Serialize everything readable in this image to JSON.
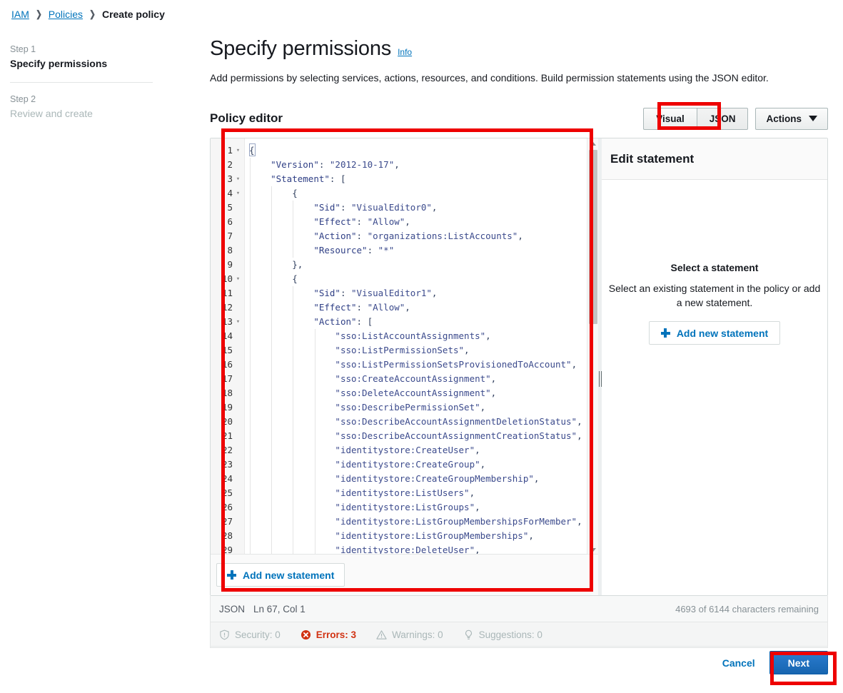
{
  "breadcrumb": {
    "items": [
      "IAM",
      "Policies",
      "Create policy"
    ],
    "separator": "❯"
  },
  "steps": [
    {
      "number": "Step 1",
      "title": "Specify permissions",
      "state": "active"
    },
    {
      "number": "Step 2",
      "title": "Review and create",
      "state": "inactive"
    }
  ],
  "header": {
    "title": "Specify permissions",
    "info_link": "Info",
    "description": "Add permissions by selecting services, actions, resources, and conditions. Build permission statements using the JSON editor."
  },
  "editor": {
    "section_title": "Policy editor",
    "tabs": [
      {
        "label": "Visual",
        "selected": false
      },
      {
        "label": "JSON",
        "selected": true
      }
    ],
    "actions_label": "Actions",
    "add_statement_label": "Add new statement",
    "cursor_line": 1,
    "first_visible_line": 1,
    "last_visible_line": 29,
    "code_lines": [
      {
        "n": 1,
        "fold": true,
        "indent": 0,
        "tokens": [
          {
            "t": "brace",
            "v": "{"
          }
        ]
      },
      {
        "n": 2,
        "fold": false,
        "indent": 1,
        "tokens": [
          {
            "t": "key",
            "v": "\"Version\""
          },
          {
            "t": "punc",
            "v": ": "
          },
          {
            "t": "str",
            "v": "\"2012-10-17\""
          },
          {
            "t": "punc",
            "v": ","
          }
        ]
      },
      {
        "n": 3,
        "fold": true,
        "indent": 1,
        "tokens": [
          {
            "t": "key",
            "v": "\"Statement\""
          },
          {
            "t": "punc",
            "v": ": ["
          }
        ]
      },
      {
        "n": 4,
        "fold": true,
        "indent": 2,
        "tokens": [
          {
            "t": "brace",
            "v": "{"
          }
        ]
      },
      {
        "n": 5,
        "fold": false,
        "indent": 3,
        "tokens": [
          {
            "t": "key",
            "v": "\"Sid\""
          },
          {
            "t": "punc",
            "v": ": "
          },
          {
            "t": "str",
            "v": "\"VisualEditor0\""
          },
          {
            "t": "punc",
            "v": ","
          }
        ]
      },
      {
        "n": 6,
        "fold": false,
        "indent": 3,
        "tokens": [
          {
            "t": "key",
            "v": "\"Effect\""
          },
          {
            "t": "punc",
            "v": ": "
          },
          {
            "t": "str",
            "v": "\"Allow\""
          },
          {
            "t": "punc",
            "v": ","
          }
        ]
      },
      {
        "n": 7,
        "fold": false,
        "indent": 3,
        "tokens": [
          {
            "t": "key",
            "v": "\"Action\""
          },
          {
            "t": "punc",
            "v": ": "
          },
          {
            "t": "str",
            "v": "\"organizations:ListAccounts\""
          },
          {
            "t": "punc",
            "v": ","
          }
        ]
      },
      {
        "n": 8,
        "fold": false,
        "indent": 3,
        "tokens": [
          {
            "t": "key",
            "v": "\"Resource\""
          },
          {
            "t": "punc",
            "v": ": "
          },
          {
            "t": "str",
            "v": "\"*\""
          }
        ]
      },
      {
        "n": 9,
        "fold": false,
        "indent": 2,
        "tokens": [
          {
            "t": "brace",
            "v": "},"
          }
        ]
      },
      {
        "n": 10,
        "fold": true,
        "indent": 2,
        "tokens": [
          {
            "t": "brace",
            "v": "{"
          }
        ]
      },
      {
        "n": 11,
        "fold": false,
        "indent": 3,
        "tokens": [
          {
            "t": "key",
            "v": "\"Sid\""
          },
          {
            "t": "punc",
            "v": ": "
          },
          {
            "t": "str",
            "v": "\"VisualEditor1\""
          },
          {
            "t": "punc",
            "v": ","
          }
        ]
      },
      {
        "n": 12,
        "fold": false,
        "indent": 3,
        "tokens": [
          {
            "t": "key",
            "v": "\"Effect\""
          },
          {
            "t": "punc",
            "v": ": "
          },
          {
            "t": "str",
            "v": "\"Allow\""
          },
          {
            "t": "punc",
            "v": ","
          }
        ]
      },
      {
        "n": 13,
        "fold": true,
        "indent": 3,
        "tokens": [
          {
            "t": "key",
            "v": "\"Action\""
          },
          {
            "t": "punc",
            "v": ": ["
          }
        ]
      },
      {
        "n": 14,
        "fold": false,
        "indent": 4,
        "tokens": [
          {
            "t": "str",
            "v": "\"sso:ListAccountAssignments\""
          },
          {
            "t": "punc",
            "v": ","
          }
        ]
      },
      {
        "n": 15,
        "fold": false,
        "indent": 4,
        "tokens": [
          {
            "t": "str",
            "v": "\"sso:ListPermissionSets\""
          },
          {
            "t": "punc",
            "v": ","
          }
        ]
      },
      {
        "n": 16,
        "fold": false,
        "indent": 4,
        "tokens": [
          {
            "t": "str",
            "v": "\"sso:ListPermissionSetsProvisionedToAccount\""
          },
          {
            "t": "punc",
            "v": ","
          }
        ]
      },
      {
        "n": 17,
        "fold": false,
        "indent": 4,
        "tokens": [
          {
            "t": "str",
            "v": "\"sso:CreateAccountAssignment\""
          },
          {
            "t": "punc",
            "v": ","
          }
        ]
      },
      {
        "n": 18,
        "fold": false,
        "indent": 4,
        "tokens": [
          {
            "t": "str",
            "v": "\"sso:DeleteAccountAssignment\""
          },
          {
            "t": "punc",
            "v": ","
          }
        ]
      },
      {
        "n": 19,
        "fold": false,
        "indent": 4,
        "tokens": [
          {
            "t": "str",
            "v": "\"sso:DescribePermissionSet\""
          },
          {
            "t": "punc",
            "v": ","
          }
        ]
      },
      {
        "n": 20,
        "fold": false,
        "indent": 4,
        "tokens": [
          {
            "t": "str",
            "v": "\"sso:DescribeAccountAssignmentDeletionStatus\""
          },
          {
            "t": "punc",
            "v": ","
          }
        ]
      },
      {
        "n": 21,
        "fold": false,
        "indent": 4,
        "tokens": [
          {
            "t": "str",
            "v": "\"sso:DescribeAccountAssignmentCreationStatus\""
          },
          {
            "t": "punc",
            "v": ","
          }
        ]
      },
      {
        "n": 22,
        "fold": false,
        "indent": 4,
        "tokens": [
          {
            "t": "str",
            "v": "\"identitystore:CreateUser\""
          },
          {
            "t": "punc",
            "v": ","
          }
        ]
      },
      {
        "n": 23,
        "fold": false,
        "indent": 4,
        "tokens": [
          {
            "t": "str",
            "v": "\"identitystore:CreateGroup\""
          },
          {
            "t": "punc",
            "v": ","
          }
        ]
      },
      {
        "n": 24,
        "fold": false,
        "indent": 4,
        "tokens": [
          {
            "t": "str",
            "v": "\"identitystore:CreateGroupMembership\""
          },
          {
            "t": "punc",
            "v": ","
          }
        ]
      },
      {
        "n": 25,
        "fold": false,
        "indent": 4,
        "tokens": [
          {
            "t": "str",
            "v": "\"identitystore:ListUsers\""
          },
          {
            "t": "punc",
            "v": ","
          }
        ]
      },
      {
        "n": 26,
        "fold": false,
        "indent": 4,
        "tokens": [
          {
            "t": "str",
            "v": "\"identitystore:ListGroups\""
          },
          {
            "t": "punc",
            "v": ","
          }
        ]
      },
      {
        "n": 27,
        "fold": false,
        "indent": 4,
        "tokens": [
          {
            "t": "str",
            "v": "\"identitystore:ListGroupMembershipsForMember\""
          },
          {
            "t": "punc",
            "v": ","
          }
        ]
      },
      {
        "n": 28,
        "fold": false,
        "indent": 4,
        "tokens": [
          {
            "t": "str",
            "v": "\"identitystore:ListGroupMemberships\""
          },
          {
            "t": "punc",
            "v": ","
          }
        ]
      },
      {
        "n": 29,
        "fold": false,
        "indent": 4,
        "tokens": [
          {
            "t": "str",
            "v": "\"identitystore:DeleteUser\""
          },
          {
            "t": "punc",
            "v": ","
          }
        ]
      }
    ]
  },
  "side_panel": {
    "title": "Edit statement",
    "empty_title": "Select a statement",
    "empty_description": "Select an existing statement in the policy or add a new statement.",
    "add_button_label": "Add new statement"
  },
  "status_bar": {
    "mode": "JSON",
    "position": "Ln 67, Col 1",
    "characters": "4693 of 6144 characters remaining"
  },
  "issues": [
    {
      "icon": "shield-icon",
      "label": "Security: 0",
      "state": "muted"
    },
    {
      "icon": "error-icon",
      "label": "Errors: 3",
      "state": "error"
    },
    {
      "icon": "warning-icon",
      "label": "Warnings: 0",
      "state": "muted"
    },
    {
      "icon": "lightbulb-icon",
      "label": "Suggestions: 0",
      "state": "muted"
    }
  ],
  "footer": {
    "cancel_label": "Cancel",
    "next_label": "Next"
  },
  "colors": {
    "accent_link": "#0073bb",
    "primary_button": "#1765b0",
    "error": "#d13212",
    "highlight_box": "#ee0000",
    "muted_text": "#aab7b8"
  }
}
